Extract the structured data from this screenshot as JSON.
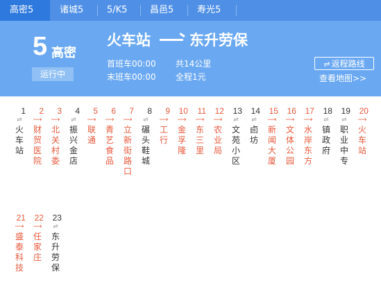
{
  "tabs": [
    {
      "label": "高密5",
      "active": true
    },
    {
      "label": "诸城5",
      "active": false
    },
    {
      "label": "5/K5",
      "active": false
    },
    {
      "label": "昌邑5",
      "active": false
    },
    {
      "label": "寿光5",
      "active": false
    }
  ],
  "route": {
    "number": "5",
    "city": "高密",
    "status": "运行中",
    "from": "火车站",
    "to": "东升劳保",
    "first_bus": "首班车00:00",
    "last_bus": "末班车00:00",
    "distance": "共14公里",
    "fare": "全程1元",
    "reverse_label": "返程路线",
    "map_link": "查看地图>>"
  },
  "stops": [
    {
      "num": "1",
      "name": "火车站",
      "color": "dark",
      "dir": "⇌"
    },
    {
      "num": "2",
      "name": "财贸医院",
      "color": "red",
      "dir": "⟶"
    },
    {
      "num": "3",
      "name": "北关村委",
      "color": "red",
      "dir": "⟶"
    },
    {
      "num": "4",
      "name": "振兴金店",
      "color": "dark",
      "dir": "⇌"
    },
    {
      "num": "5",
      "name": "联通",
      "color": "red",
      "dir": "⟶"
    },
    {
      "num": "6",
      "name": "青艺食品",
      "color": "red",
      "dir": "⟶"
    },
    {
      "num": "7",
      "name": "立新街路口",
      "color": "red",
      "dir": "⟶"
    },
    {
      "num": "8",
      "name": "碾头鞋城",
      "color": "dark",
      "dir": "⇌"
    },
    {
      "num": "9",
      "name": "工行",
      "color": "red",
      "dir": "⟶"
    },
    {
      "num": "10",
      "name": "金孚隆",
      "color": "red",
      "dir": "⟶"
    },
    {
      "num": "11",
      "name": "东三里",
      "color": "red",
      "dir": "⟶"
    },
    {
      "num": "12",
      "name": "农业局",
      "color": "red",
      "dir": "⟶"
    },
    {
      "num": "13",
      "name": "文苑小区",
      "color": "dark",
      "dir": "⇌"
    },
    {
      "num": "14",
      "name": "卣坊",
      "color": "dark",
      "dir": "⇌"
    },
    {
      "num": "15",
      "name": "新闻大厦",
      "color": "red",
      "dir": "⟶"
    },
    {
      "num": "16",
      "name": "文体公园",
      "color": "red",
      "dir": "⟶"
    },
    {
      "num": "17",
      "name": "水岸东方",
      "color": "red",
      "dir": "⟶"
    },
    {
      "num": "18",
      "name": "镇政府",
      "color": "dark",
      "dir": "⇌"
    },
    {
      "num": "19",
      "name": "职业中专",
      "color": "dark",
      "dir": "⇌"
    },
    {
      "num": "20",
      "name": "火车站",
      "color": "red",
      "dir": "⟶"
    },
    {
      "num": "21",
      "name": "盛泰科技",
      "color": "red",
      "dir": "⟶"
    },
    {
      "num": "22",
      "name": "任家庄",
      "color": "red",
      "dir": "⟶"
    },
    {
      "num": "23",
      "name": "东升劳保",
      "color": "dark",
      "dir": "⇌"
    }
  ]
}
